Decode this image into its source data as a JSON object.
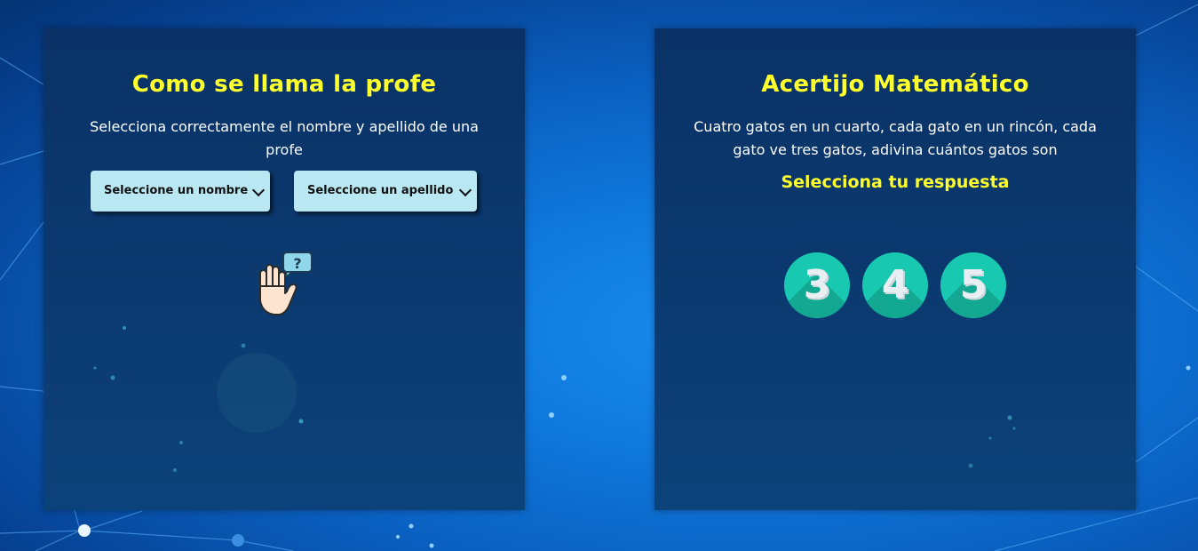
{
  "left_panel": {
    "title": "Como se llama la profe",
    "description": "Selecciona correctamente el nombre y apellido de una profe",
    "name_select": {
      "selected": "Seleccione un nombre"
    },
    "surname_select": {
      "selected": "Seleccione un apellido"
    },
    "hint_icon": "raised-hand-question-icon"
  },
  "right_panel": {
    "title": "Acertijo Matemático",
    "description": "Cuatro gatos en un cuarto, cada gato en un rincón, cada gato ve tres gatos, adivina cuántos gatos son",
    "prompt": "Selecciona tu respuesta",
    "answers": [
      "3",
      "4",
      "5"
    ]
  },
  "colors": {
    "title": "#ffff2b",
    "panel": "#0b3a70",
    "select": "#b9e7f2",
    "answer_circle": "#19c8b0",
    "background": "#0f78dc"
  }
}
